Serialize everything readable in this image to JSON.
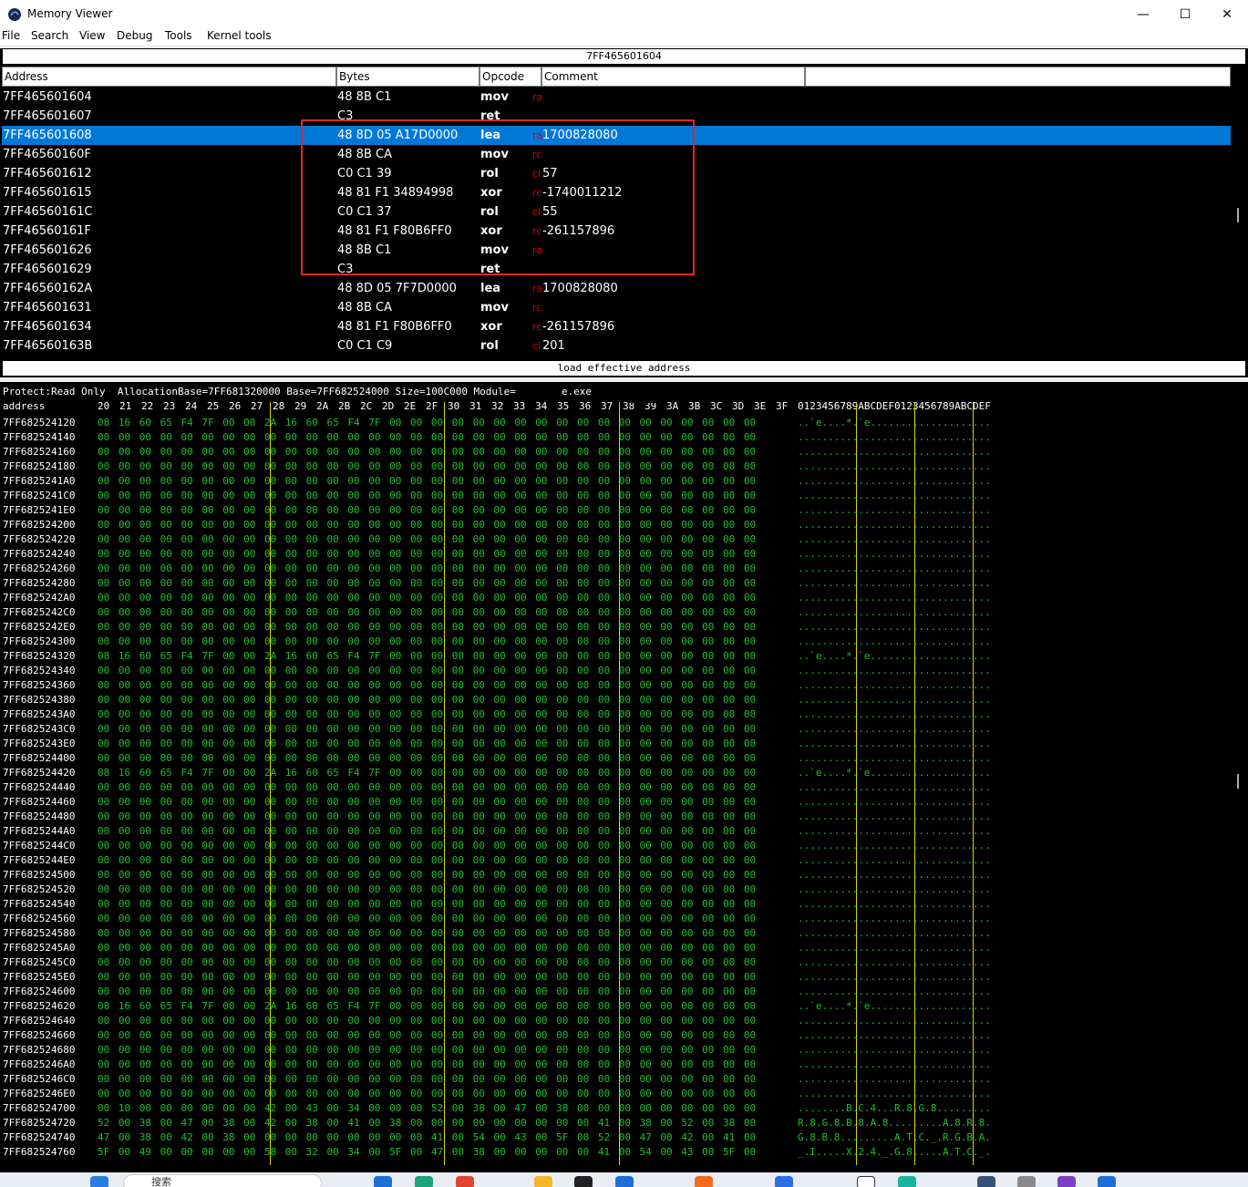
{
  "window": {
    "title": "Memory Viewer",
    "minimize": "—",
    "maximize": "☐",
    "close": "✕"
  },
  "menu": [
    "File",
    "Search",
    "View",
    "Debug",
    "Tools",
    "Kernel tools"
  ],
  "disassembler": {
    "address_bar": "7FF465601604",
    "columns": [
      "Address",
      "Bytes",
      "Opcode",
      "Comment"
    ],
    "rows": [
      {
        "address": "7FF465601604",
        "bytes": "48 8B C1",
        "opcode": "mov",
        "reg": "ra",
        "comment": ""
      },
      {
        "address": "7FF465601607",
        "bytes": "C3",
        "opcode": "ret",
        "reg": "",
        "comment": ""
      },
      {
        "address": "7FF465601608",
        "bytes": "48 8D 05 A17D0000",
        "opcode": "lea",
        "reg": "ra",
        "comment": "1700828080"
      },
      {
        "address": "7FF46560160F",
        "bytes": "48 8B CA",
        "opcode": "mov",
        "reg": "rc",
        "comment": ""
      },
      {
        "address": "7FF465601612",
        "bytes": "C0 C1 39",
        "opcode": "rol",
        "reg": "cl",
        "comment": "57"
      },
      {
        "address": "7FF465601615",
        "bytes": "48 81 F1 34894998",
        "opcode": "xor",
        "reg": "rc",
        "comment": "-1740011212"
      },
      {
        "address": "7FF46560161C",
        "bytes": "C0 C1 37",
        "opcode": "rol",
        "reg": "cl",
        "comment": "55"
      },
      {
        "address": "7FF46560161F",
        "bytes": "48 81 F1 F80B6FF0",
        "opcode": "xor",
        "reg": "rc",
        "comment": "-261157896"
      },
      {
        "address": "7FF465601626",
        "bytes": "48 8B C1",
        "opcode": "mov",
        "reg": "ra",
        "comment": ""
      },
      {
        "address": "7FF465601629",
        "bytes": "C3",
        "opcode": "ret",
        "reg": "",
        "comment": ""
      },
      {
        "address": "7FF46560162A",
        "bytes": "48 8D 05 7F7D0000",
        "opcode": "lea",
        "reg": "ra",
        "comment": "1700828080"
      },
      {
        "address": "7FF465601631",
        "bytes": "48 8B CA",
        "opcode": "mov",
        "reg": "rc",
        "comment": ""
      },
      {
        "address": "7FF465601634",
        "bytes": "48 81 F1 F80B6FF0",
        "opcode": "xor",
        "reg": "rc",
        "comment": "-261157896"
      },
      {
        "address": "7FF46560163B",
        "bytes": "C0 C1 C9",
        "opcode": "rol",
        "reg": "cl",
        "comment": "201"
      }
    ],
    "selected_index": 2,
    "status": "load effective address"
  },
  "hexview": {
    "info": "Protect:Read Only  AllocationBase=7FF681320000 Base=7FF682524000 Size=100C000 Module=",
    "module_suffix": "e.exe",
    "header_label": "address",
    "header_offsets": [
      "20",
      "21",
      "22",
      "23",
      "24",
      "25",
      "26",
      "27",
      "28",
      "29",
      "2A",
      "2B",
      "2C",
      "2D",
      "2E",
      "2F",
      "30",
      "31",
      "32",
      "33",
      "34",
      "35",
      "36",
      "37",
      "38",
      "39",
      "3A",
      "3B",
      "3C",
      "3D",
      "3E",
      "3F"
    ],
    "ascii_header": "0123456789ABCDEF0123456789ABCDEF",
    "rows": [
      {
        "a": "7FF682524120",
        "b": "08 16 60 65 F4 7F 00 00 2A 16 60 65 F4 7F 00 00 00 00 00 00 00 00 00 00 00 00 00 00 00 00 00 00",
        "t": "..`e....*.`e...................."
      },
      {
        "a": "7FF682524140",
        "b": "",
        "t": ""
      },
      {
        "a": "7FF682524160",
        "b": "",
        "t": ""
      },
      {
        "a": "7FF682524180",
        "b": "",
        "t": ""
      },
      {
        "a": "7FF6825241A0",
        "b": "",
        "t": ""
      },
      {
        "a": "7FF6825241C0",
        "b": "",
        "t": ""
      },
      {
        "a": "7FF6825241E0",
        "b": "",
        "t": ""
      },
      {
        "a": "7FF682524200",
        "b": "",
        "t": ""
      },
      {
        "a": "7FF682524220",
        "b": "",
        "t": ""
      },
      {
        "a": "7FF682524240",
        "b": "",
        "t": ""
      },
      {
        "a": "7FF682524260",
        "b": "",
        "t": ""
      },
      {
        "a": "7FF682524280",
        "b": "",
        "t": ""
      },
      {
        "a": "7FF6825242A0",
        "b": "",
        "t": ""
      },
      {
        "a": "7FF6825242C0",
        "b": "",
        "t": ""
      },
      {
        "a": "7FF6825242E0",
        "b": "",
        "t": ""
      },
      {
        "a": "7FF682524300",
        "b": "",
        "t": ""
      },
      {
        "a": "7FF682524320",
        "b": "08 16 60 65 F4 7F 00 00 2A 16 60 65 F4 7F 00 00 00 00 00 00 00 00 00 00 00 00 00 00 00 00 00 00",
        "t": "..`e....*.`e...................."
      },
      {
        "a": "7FF682524340",
        "b": "",
        "t": ""
      },
      {
        "a": "7FF682524360",
        "b": "",
        "t": ""
      },
      {
        "a": "7FF682524380",
        "b": "",
        "t": ""
      },
      {
        "a": "7FF6825243A0",
        "b": "",
        "t": ""
      },
      {
        "a": "7FF6825243C0",
        "b": "",
        "t": ""
      },
      {
        "a": "7FF6825243E0",
        "b": "",
        "t": ""
      },
      {
        "a": "7FF682524400",
        "b": "",
        "t": ""
      },
      {
        "a": "7FF682524420",
        "b": "08 16 60 65 F4 7F 00 00 2A 16 60 65 F4 7F 00 00 00 00 00 00 00 00 00 00 00 00 00 00 00 00 00 00",
        "t": "..`e....*.`e...................."
      },
      {
        "a": "7FF682524440",
        "b": "",
        "t": ""
      },
      {
        "a": "7FF682524460",
        "b": "",
        "t": ""
      },
      {
        "a": "7FF682524480",
        "b": "",
        "t": ""
      },
      {
        "a": "7FF6825244A0",
        "b": "",
        "t": ""
      },
      {
        "a": "7FF6825244C0",
        "b": "",
        "t": ""
      },
      {
        "a": "7FF6825244E0",
        "b": "",
        "t": ""
      },
      {
        "a": "7FF682524500",
        "b": "",
        "t": ""
      },
      {
        "a": "7FF682524520",
        "b": "",
        "t": ""
      },
      {
        "a": "7FF682524540",
        "b": "",
        "t": ""
      },
      {
        "a": "7FF682524560",
        "b": "",
        "t": ""
      },
      {
        "a": "7FF682524580",
        "b": "",
        "t": ""
      },
      {
        "a": "7FF6825245A0",
        "b": "",
        "t": ""
      },
      {
        "a": "7FF6825245C0",
        "b": "",
        "t": ""
      },
      {
        "a": "7FF6825245E0",
        "b": "",
        "t": ""
      },
      {
        "a": "7FF682524600",
        "b": "",
        "t": ""
      },
      {
        "a": "7FF682524620",
        "b": "08 16 60 65 F4 7F 00 00 2A 16 60 65 F4 7F 00 00 00 00 00 00 00 00 00 00 00 00 00 00 00 00 00 00",
        "t": "..`e....*.`e...................."
      },
      {
        "a": "7FF682524640",
        "b": "",
        "t": ""
      },
      {
        "a": "7FF682524660",
        "b": "",
        "t": ""
      },
      {
        "a": "7FF682524680",
        "b": "",
        "t": ""
      },
      {
        "a": "7FF6825246A0",
        "b": "",
        "t": ""
      },
      {
        "a": "7FF6825246C0",
        "b": "",
        "t": ""
      },
      {
        "a": "7FF6825246E0",
        "b": "",
        "t": ""
      },
      {
        "a": "7FF682524700",
        "b": "00 10 00 00 00 00 00 00 42 00 43 00 34 00 00 00 52 00 38 00 47 00 38 00 00 00 00 00 00 00 00 00",
        "t": "........B.C.4...R.8.G.8........."
      },
      {
        "a": "7FF682524720",
        "b": "52 00 38 00 47 00 38 00 42 00 38 00 41 00 38 00 00 00 00 00 00 00 00 00 41 00 38 00 52 00 38 00",
        "t": "R.8.G.8.B.8.A.8.........A.8.R.8."
      },
      {
        "a": "7FF682524740",
        "b": "47 00 38 00 42 00 38 00 00 00 00 00 00 00 00 00 41 00 54 00 43 00 5F 00 52 00 47 00 42 00 41 00",
        "t": "G.8.B.8.........A.T.C._.R.G.B.A."
      },
      {
        "a": "7FF682524760",
        "b": "5F 00 49 00 00 00 00 00 58 00 32 00 34 00 5F 00 47 00 38 00 00 00 00 00 41 00 54 00 43 00 5F 00",
        "t": "_.I.....X.2.4._.G.8.....A.T.C._."
      }
    ]
  },
  "taskbar": {
    "search_placeholder": "搜索"
  },
  "colors": {
    "selection": "#0078d7",
    "hex_text": "#1dbf2b",
    "register_text": "#e00000",
    "annotation": "#e0262b",
    "separator_line": "#d8d800"
  }
}
